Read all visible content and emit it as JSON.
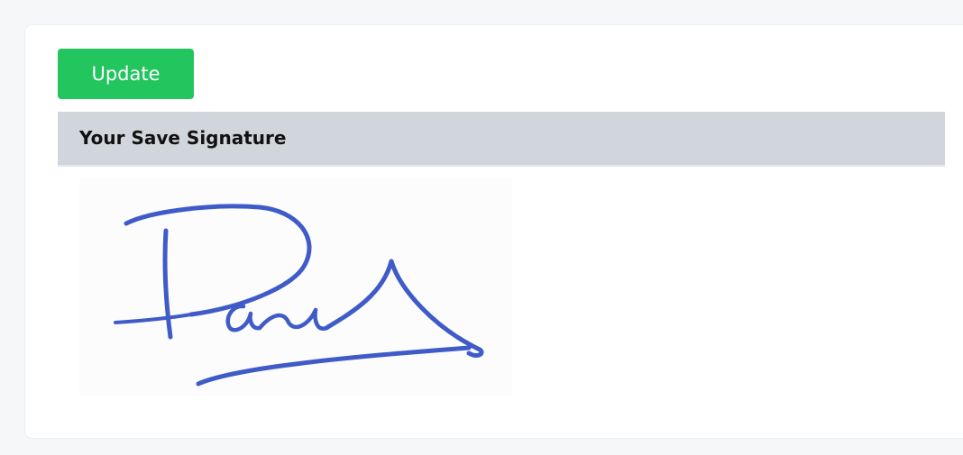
{
  "toolbar": {
    "update_label": "Update",
    "update_color": "#22c55e"
  },
  "section": {
    "title": "Your Save Signature"
  },
  "signature": {
    "ink_color": "#3f5bc7",
    "handwritten_text": "Paul"
  }
}
